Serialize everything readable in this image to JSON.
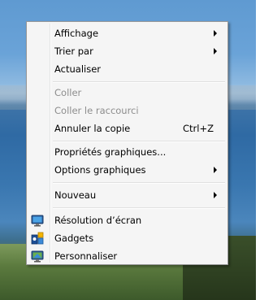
{
  "menu": {
    "items": [
      {
        "label": "Affichage",
        "has_submenu": true
      },
      {
        "label": "Trier par",
        "has_submenu": true
      },
      {
        "label": "Actualiser"
      },
      {
        "label": "Coller",
        "disabled": true
      },
      {
        "label": "Coller le raccourci",
        "disabled": true
      },
      {
        "label": "Annuler la copie",
        "shortcut": "Ctrl+Z"
      },
      {
        "label": "Propriétés graphiques..."
      },
      {
        "label": "Options graphiques",
        "has_submenu": true
      },
      {
        "label": "Nouveau",
        "has_submenu": true
      },
      {
        "label": "Résolution d’écran",
        "icon": "monitor-icon"
      },
      {
        "label": "Gadgets",
        "icon": "gadgets-icon"
      },
      {
        "label": "Personnaliser",
        "icon": "personalize-icon"
      }
    ]
  }
}
